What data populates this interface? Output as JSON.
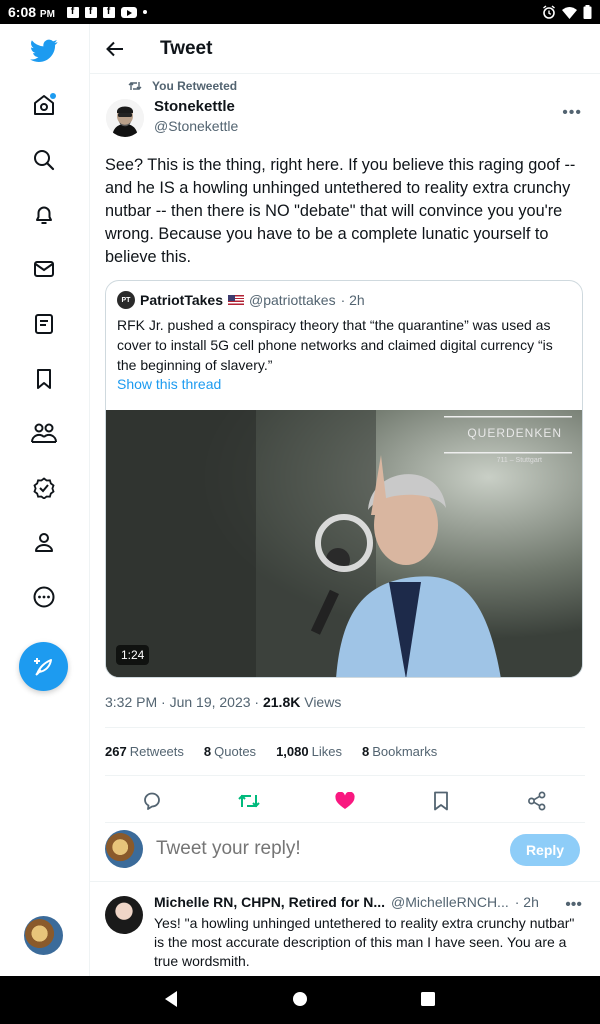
{
  "status_bar": {
    "time": "6:08",
    "ampm": "PM"
  },
  "sidebar": {
    "items": [
      {
        "name": "twitter-logo-icon",
        "label": "Twitter"
      },
      {
        "name": "home-icon",
        "label": "Home"
      },
      {
        "name": "explore-icon",
        "label": "Explore"
      },
      {
        "name": "notifications-icon",
        "label": "Notifications"
      },
      {
        "name": "messages-icon",
        "label": "Messages"
      },
      {
        "name": "lists-icon",
        "label": "Lists"
      },
      {
        "name": "bookmarks-icon",
        "label": "Bookmarks"
      },
      {
        "name": "communities-icon",
        "label": "Communities"
      },
      {
        "name": "verified-icon",
        "label": "Verified"
      },
      {
        "name": "profile-icon",
        "label": "Profile"
      },
      {
        "name": "more-icon",
        "label": "More"
      }
    ]
  },
  "header": {
    "title": "Tweet"
  },
  "tweet": {
    "retweet_label": "You Retweeted",
    "author_name": "Stonekettle",
    "author_handle": "@Stonekettle",
    "text": "See? This is the thing, right here. If you believe this raging goof -- and he IS a howling unhinged untethered to reality extra crunchy nutbar -- then there is NO \"debate\" that will convince you you're wrong. Because you have to be a complete lunatic yourself to believe this.",
    "quote": {
      "avatar_text": "PT",
      "name": "PatriotTakes",
      "handle": "@patriottakes",
      "time": "· 2h",
      "text": "RFK Jr. pushed a conspiracy theory that “the quarantine” was used as cover to install 5G cell phone networks and claimed digital currency “is the beginning of slavery.”",
      "link": "Show this thread",
      "video_duration": "1:24",
      "video_brand": "QUERDENKEN",
      "video_brand_sub": "711 – Stuttgart"
    },
    "timestamp": "3:32 PM · Jun 19, 2023 · ",
    "views_count": "21.8K",
    "views_label": " Views",
    "stats": {
      "retweets_count": "267",
      "retweets_label": "Retweets",
      "quotes_count": "8",
      "quotes_label": "Quotes",
      "likes_count": "1,080",
      "likes_label": "Likes",
      "bookmarks_count": "8",
      "bookmarks_label": "Bookmarks"
    }
  },
  "reply_composer": {
    "placeholder": "Tweet your reply!",
    "button": "Reply"
  },
  "replies": [
    {
      "name": "Michelle RN, CHPN, Retired for N...",
      "handle": "@MichelleRNCH...",
      "time": "· 2h",
      "text": "Yes! \"a howling unhinged untethered to reality extra crunchy nutbar\" is the most accurate description of this man I have seen. You are a true wordsmith."
    }
  ],
  "colors": {
    "accent": "#1d9bf0",
    "retweet_green": "#00ba7c",
    "like_pink": "#f91880",
    "text_secondary": "#536471"
  }
}
